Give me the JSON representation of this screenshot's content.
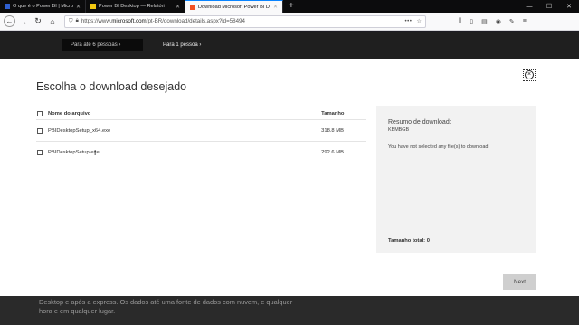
{
  "browser": {
    "tabs": [
      {
        "label": "O que é o Power BI | Microsoft",
        "active": false,
        "favicon_color": "#2f5fd0"
      },
      {
        "label": "Power BI Desktop — Relatóri",
        "active": false,
        "favicon_color": "#f2c811"
      },
      {
        "label": "Download Microsoft Power BI D",
        "active": true,
        "favicon_color": "#f25022"
      }
    ],
    "new_tab_label": "+",
    "url_prefix": "https://www.",
    "url_host": "microsoft.com",
    "url_path": "/pt-BR/download/details.aspx?id=58494",
    "url_dots": "•••"
  },
  "page": {
    "button_first": "Para até 6 pessoas ›",
    "button_second": "Para 1 pessoa ›",
    "bottom_text_line1": "Desktop e após a express. Os dados até uma fonte de dados com nuvem, e qualquer",
    "bottom_text_line2": "hora e em qualquer lugar."
  },
  "modal": {
    "title": "Escolha o download desejado",
    "close_glyph": "×",
    "table": {
      "header_name": "Nome do arquivo",
      "header_size": "Tamanho",
      "files": [
        {
          "name": "PBIDesktopSetup_x64.exe",
          "size": "318.8 MB",
          "checked": false
        },
        {
          "name": "PBIDesktopSetup.exe",
          "size": "292.6 MB",
          "checked": false
        }
      ]
    },
    "summary": {
      "title": "Resumo de download:",
      "size": "KBMBGB",
      "message": "You have not selected any file(s) to download.",
      "total": "Tamanho total: 0"
    },
    "next_label": "Next"
  }
}
